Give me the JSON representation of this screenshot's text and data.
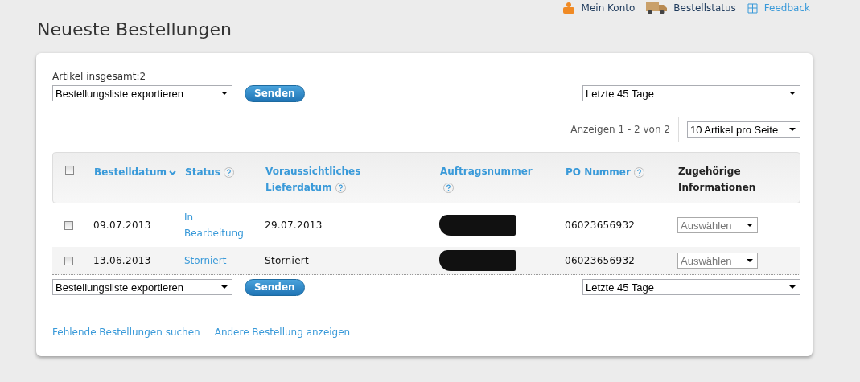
{
  "header_links": [
    {
      "label": "Mein Konto",
      "kind": "account"
    },
    {
      "label": "Bestellstatus",
      "kind": "truck"
    },
    {
      "label": "Feedback",
      "kind": "feedback"
    }
  ],
  "title": "Neueste Bestellungen",
  "total": "Artikel insgesamt:2",
  "top_toolbar": {
    "export": "Bestellungsliste exportieren",
    "button": "Senden",
    "range": "Letzte 45 Tage"
  },
  "pagination": {
    "summary": "Anzeigen 1 - 2 von 2",
    "per_page": "10 Artikel pro Seite"
  },
  "table": {
    "select_all": false,
    "columns": [
      {
        "label": "Bestelldatum",
        "link": true,
        "sorted": true,
        "help": false
      },
      {
        "label": "Status",
        "link": true,
        "sorted": false,
        "help": true
      },
      {
        "label": "Voraussichtliches Lieferdatum",
        "link": true,
        "sorted": false,
        "help": true
      },
      {
        "label": "Auftragsnummer",
        "link": true,
        "sorted": false,
        "help": true
      },
      {
        "label": "PO Nummer",
        "link": true,
        "sorted": false,
        "help": true
      },
      {
        "label": "Zugehörige Informationen",
        "link": false,
        "sorted": false,
        "help": false
      }
    ],
    "rows": [
      {
        "selected": false,
        "date": "09.07.2013",
        "status": "In Bearbeitung",
        "delivery": "29.07.2013",
        "po": "06023656932",
        "action": "Auswählen"
      },
      {
        "selected": false,
        "date": "13.06.2013",
        "status": "Storniert",
        "delivery": "Storniert",
        "po": "06023656932",
        "action": "Auswählen"
      }
    ]
  },
  "bottom_toolbar": {
    "export": "Bestellungsliste exportieren",
    "button": "Senden",
    "range": "Letzte 45 Tage"
  },
  "footer_links": [
    "Fehlende Bestellungen suchen",
    "Andere Bestellung anzeigen"
  ]
}
